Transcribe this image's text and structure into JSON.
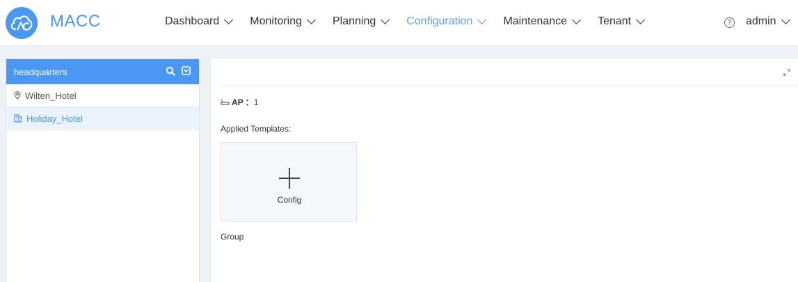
{
  "header": {
    "brand": "MACC",
    "nav": [
      {
        "label": "Dashboard"
      },
      {
        "label": "Monitoring"
      },
      {
        "label": "Planning"
      },
      {
        "label": "Configuration",
        "active": true
      },
      {
        "label": "Maintenance"
      },
      {
        "label": "Tenant"
      }
    ],
    "help_glyph": "?",
    "user": "admin"
  },
  "left_panel": {
    "title": "headquarters",
    "items": [
      {
        "label": "Wilten_Hotel",
        "icon": "location-pin-icon"
      },
      {
        "label": "Holiday_Hotel",
        "icon": "building-icon",
        "selected": true
      }
    ]
  },
  "main": {
    "ap_label": "AP",
    "ap_sep": "：",
    "ap_value": "1",
    "applied_templates": "Applied Templates:",
    "config_label": "Config",
    "group_label": "Group"
  },
  "colors": {
    "accent": "#4a98f4",
    "nav_active": "#5b9ef2",
    "selected_bg": "#eaf3fe"
  }
}
